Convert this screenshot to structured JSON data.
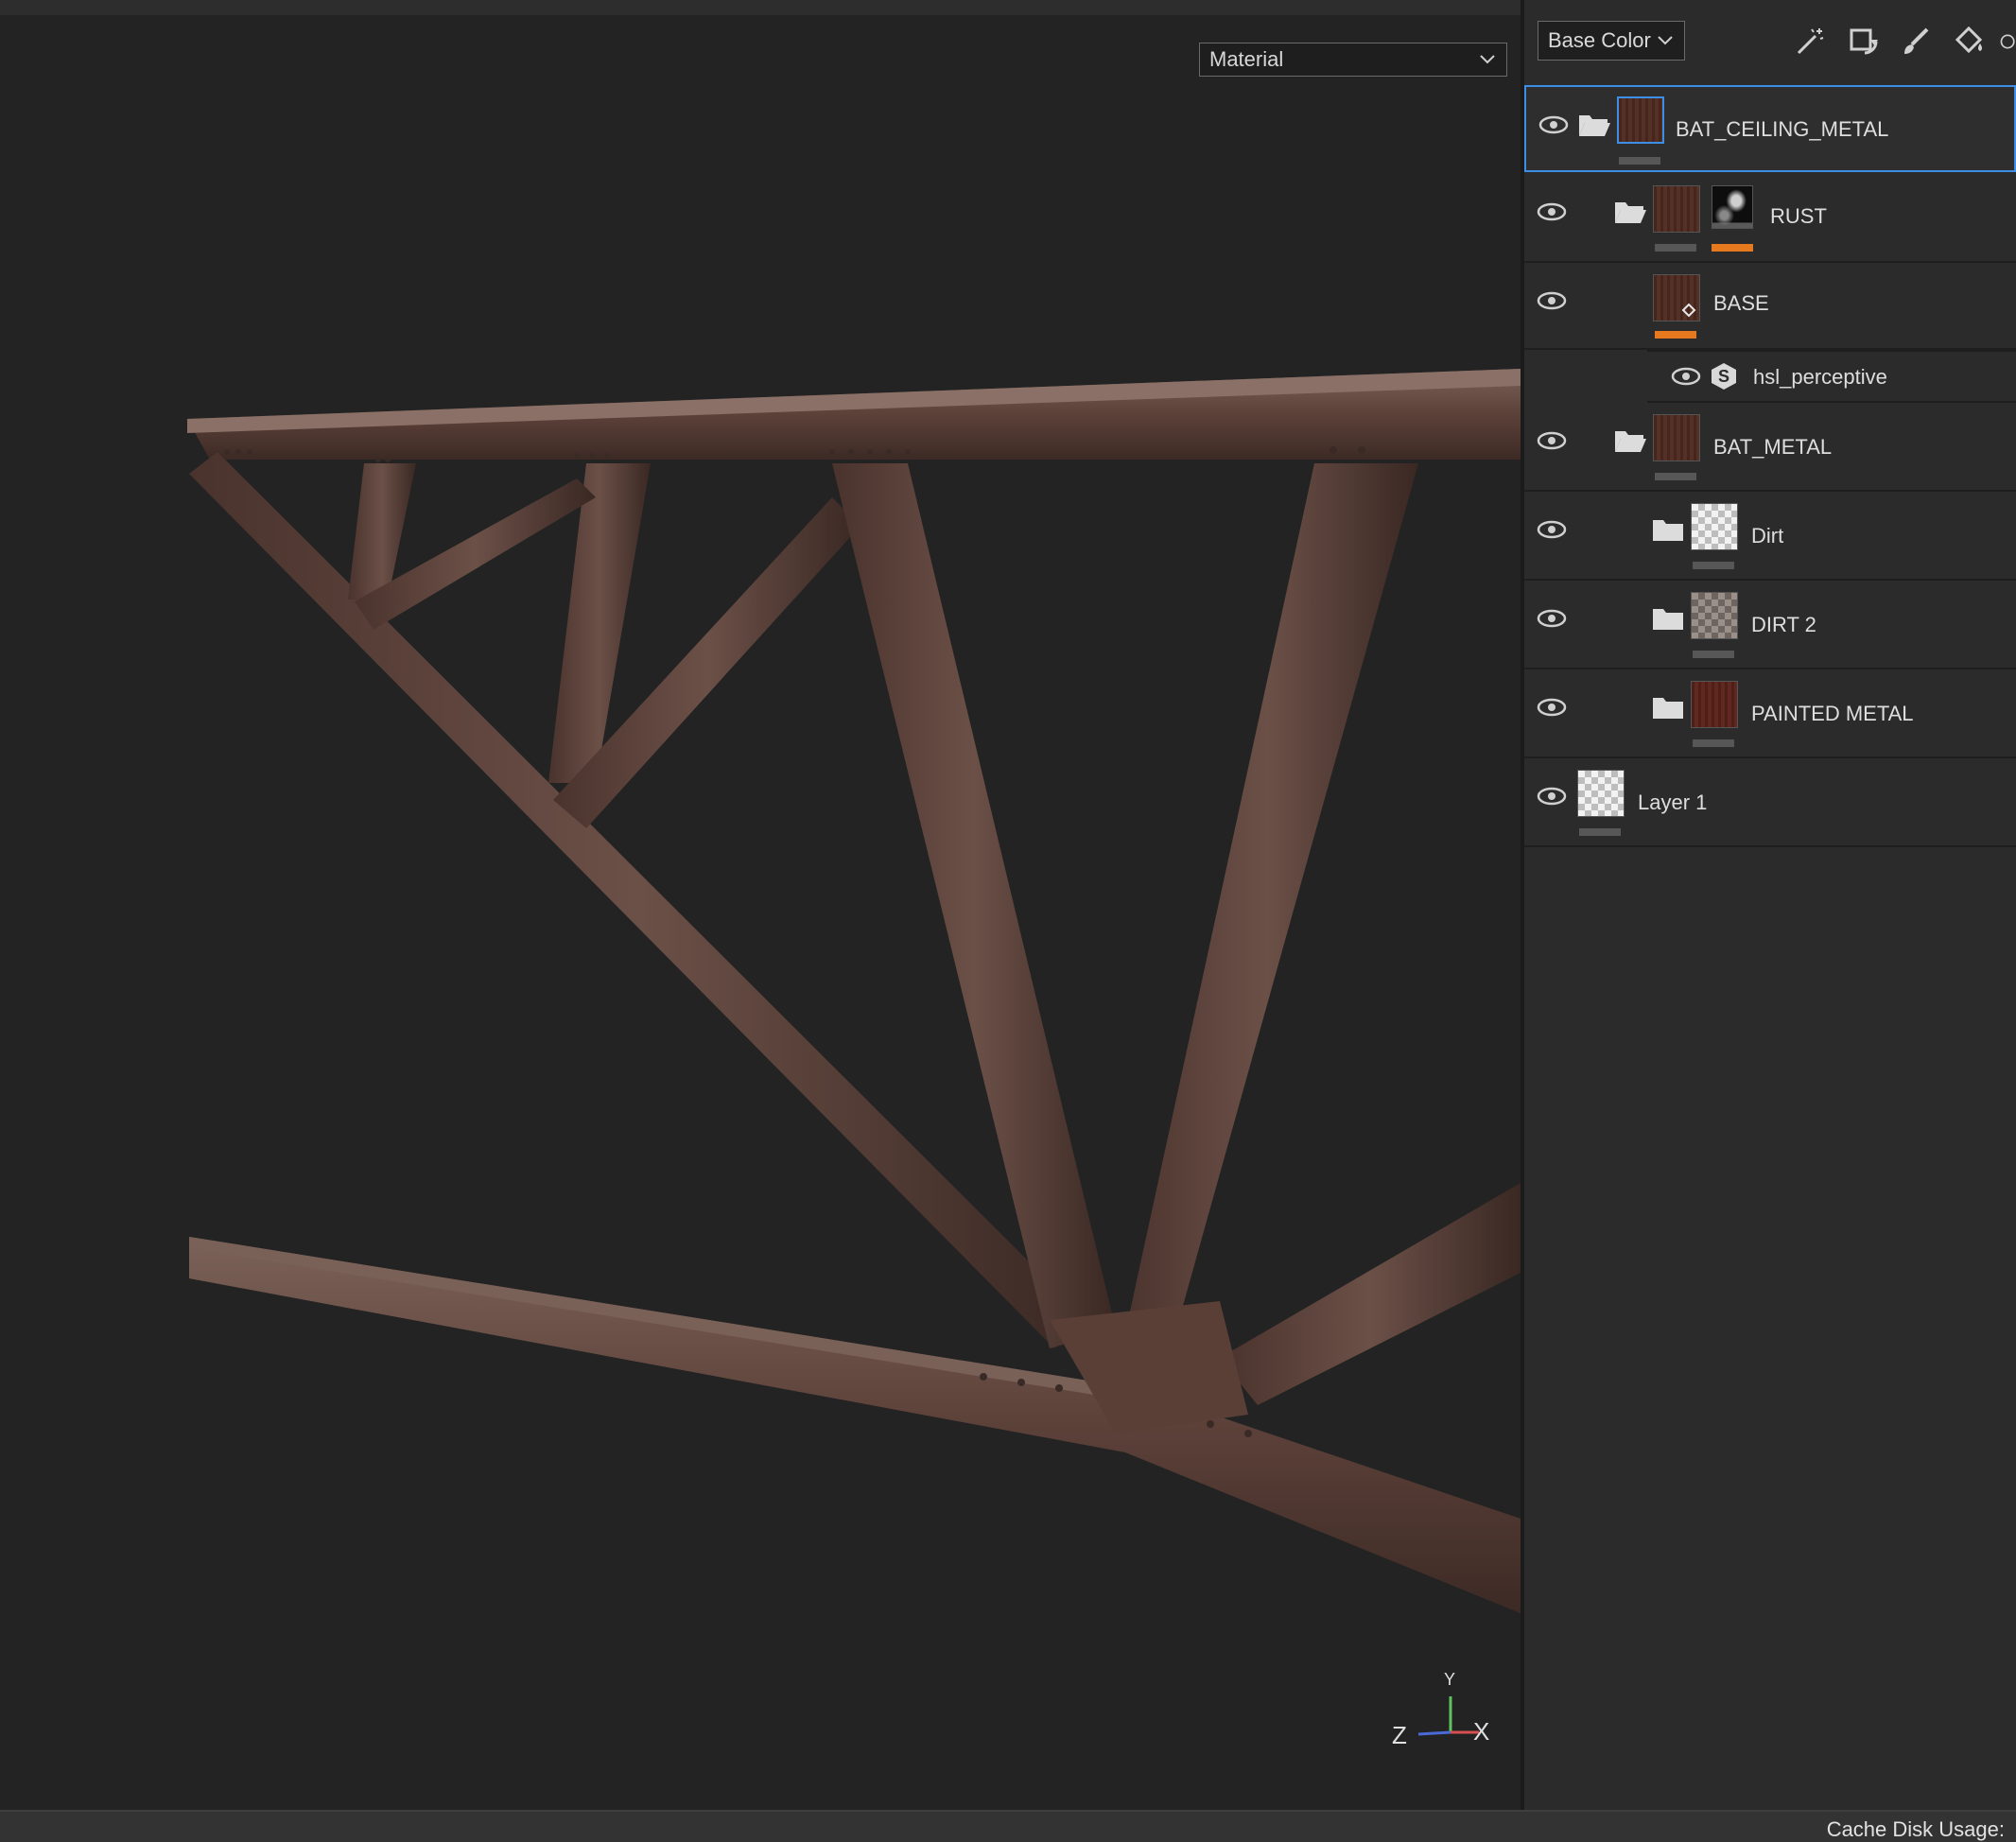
{
  "viewport": {
    "shading_mode": "Material",
    "axis": {
      "x_label": "X",
      "y_label": "Y",
      "z_label": "Z"
    }
  },
  "panel": {
    "channel": "Base Color",
    "tools": [
      "magic-wand-icon",
      "rotate-icon",
      "brush-icon",
      "fill-bucket-icon",
      "partial-icon"
    ],
    "layers": [
      {
        "name": "BAT_CEILING_METAL",
        "kind": "folder",
        "selected": true
      },
      {
        "name": "RUST",
        "kind": "folder",
        "has_mask": true,
        "mask_bar_color": "#e6781e"
      },
      {
        "name": "BASE",
        "kind": "fill",
        "bar_color": "#e6781e"
      },
      {
        "name": "hsl_perceptive",
        "kind": "filter",
        "icon": "substance-filter-icon"
      },
      {
        "name": "BAT_METAL",
        "kind": "folder"
      },
      {
        "name": "Dirt",
        "kind": "folder-closed"
      },
      {
        "name": "DIRT 2",
        "kind": "folder-closed"
      },
      {
        "name": "PAINTED METAL",
        "kind": "folder-closed"
      },
      {
        "name": "Layer 1",
        "kind": "layer"
      }
    ]
  },
  "status": {
    "cache_label": "Cache Disk Usage:"
  },
  "colors": {
    "accent": "#3d8ee6",
    "highlight": "#e6781e",
    "metal": "#5a4038"
  }
}
